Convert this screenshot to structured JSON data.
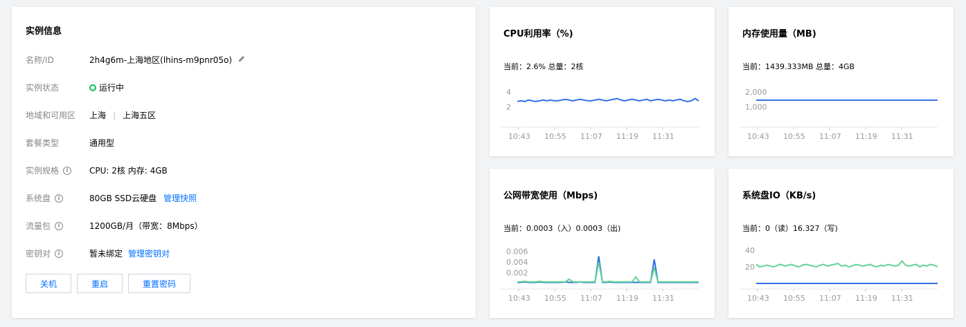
{
  "instance": {
    "title": "实例信息",
    "rows": [
      {
        "label": "名称/ID",
        "value": "2h4g6m-上海地区(lhins-m9pnr05o)",
        "has_edit": true
      },
      {
        "label": "实例状态",
        "value": "运行中",
        "status": "running"
      },
      {
        "label": "地域和可用区",
        "region": "上海",
        "sep": "|",
        "zone": "上海五区"
      },
      {
        "label": "套餐类型",
        "value": "通用型"
      },
      {
        "label": "实例规格",
        "value": "CPU: 2核 内存: 4GB",
        "info": true
      },
      {
        "label": "系统盘",
        "value": "80GB SSD云硬盘",
        "link": "管理快照",
        "info": true
      },
      {
        "label": "流量包",
        "value": "1200GB/月（带宽：8Mbps）",
        "info": true
      },
      {
        "label": "密钥对",
        "value": "暂未绑定",
        "link": "管理密钥对",
        "info": true
      }
    ],
    "buttons": {
      "shutdown": "关机",
      "restart": "重启",
      "reset_password": "重置密码"
    }
  },
  "colors": {
    "blue": "#2f6fe4",
    "green": "#5fd394",
    "link": "#006eff",
    "status_green": "#0abf5b"
  },
  "metrics": {
    "cpu": {
      "title": "CPU利用率（%)",
      "summary": "当前：2.6% 总量：2核"
    },
    "memory": {
      "title": "内存使用量（MB)",
      "summary": "当前：1439.333MB 总量：4GB"
    },
    "bandwidth": {
      "title": "公网带宽使用（Mbps)",
      "summary": "当前：0.0003（入）0.0003（出)"
    },
    "disk": {
      "title": "系统盘IO（KB/s)",
      "summary": "当前：0（读）16.327（写)"
    }
  },
  "chart_data": [
    {
      "type": "line",
      "x_ticks": [
        "10:43",
        "10:55",
        "11:07",
        "11:19",
        "11:31"
      ],
      "y_ticks": [
        "4",
        "2"
      ],
      "ylim": [
        0,
        5
      ],
      "series": [
        {
          "values": [
            2.7,
            2.8,
            2.7,
            2.9,
            2.8,
            2.7,
            2.8,
            2.9,
            2.8,
            2.9,
            2.8,
            2.8,
            2.9,
            3.0,
            2.9,
            2.8,
            2.9,
            3.0,
            2.9,
            2.8,
            2.8,
            2.9,
            3.0,
            2.9,
            2.8,
            2.9,
            3.0,
            3.1,
            2.9,
            2.8,
            2.9,
            3.0,
            2.9,
            2.8,
            2.9,
            3.0,
            2.8,
            2.9,
            3.0,
            2.9,
            2.8,
            2.9,
            2.8,
            2.9,
            3.0,
            2.8,
            2.7,
            2.8,
            3.1,
            2.8
          ],
          "color": "#2f6fe4"
        }
      ],
      "grid": false
    },
    {
      "type": "line",
      "x_ticks": [
        "10:43",
        "10:55",
        "11:07",
        "11:19",
        "11:31"
      ],
      "y_ticks": [
        "2,000",
        "1,000"
      ],
      "ylim": [
        0,
        2500
      ],
      "series": [
        {
          "values": [
            1440,
            1440,
            1440,
            1440,
            1440,
            1440,
            1440,
            1440,
            1440,
            1440,
            1440,
            1440,
            1440,
            1440,
            1440,
            1440,
            1440,
            1440,
            1440,
            1440
          ],
          "color": "#2f6fe4"
        }
      ],
      "grid": false
    },
    {
      "type": "line",
      "x_ticks": [
        "10:43",
        "10:55",
        "11:07",
        "11:19",
        "11:31"
      ],
      "y_ticks": [
        "0.006",
        "0.004",
        "0.002"
      ],
      "ylim": [
        0,
        0.007
      ],
      "series": [
        {
          "name": "in",
          "values": [
            0.0002,
            0.0002,
            0.0003,
            0.0002,
            0.0002,
            0.0002,
            0.0003,
            0.0002,
            0.0002,
            0.0002,
            0.0002,
            0.0002,
            0.0002,
            0.0003,
            0.0002,
            0.0002,
            0.0002,
            0.0003,
            0.0002,
            0.0002,
            0.0002,
            0.0002,
            0.0051,
            0.0002,
            0.0002,
            0.0003,
            0.0002,
            0.0002,
            0.0002,
            0.0002,
            0.0002,
            0.0002,
            0.0002,
            0.0002,
            0.0002,
            0.0002,
            0.0002,
            0.0045,
            0.0002,
            0.0002,
            0.0002,
            0.0002,
            0.0002,
            0.0002,
            0.0002,
            0.0002,
            0.0002,
            0.0002,
            0.0002,
            0.0002
          ],
          "color": "#2f6fe4"
        },
        {
          "name": "out",
          "values": [
            0.0003,
            0.0003,
            0.0004,
            0.0003,
            0.0003,
            0.0003,
            0.0004,
            0.0003,
            0.0003,
            0.0003,
            0.0003,
            0.0003,
            0.0003,
            0.0003,
            0.0008,
            0.0003,
            0.0003,
            0.0003,
            0.0003,
            0.0003,
            0.0003,
            0.0003,
            0.004,
            0.0003,
            0.0003,
            0.0004,
            0.0003,
            0.0003,
            0.0003,
            0.0003,
            0.0003,
            0.0003,
            0.0012,
            0.0003,
            0.0003,
            0.0003,
            0.0003,
            0.003,
            0.0003,
            0.0003,
            0.0003,
            0.0003,
            0.0003,
            0.0003,
            0.0003,
            0.0003,
            0.0003,
            0.0003,
            0.0003,
            0.0003
          ],
          "color": "#5fd394"
        }
      ],
      "grid": false
    },
    {
      "type": "line",
      "x_ticks": [
        "10:43",
        "10:55",
        "11:07",
        "11:19",
        "11:31"
      ],
      "y_ticks": [
        "40",
        "20"
      ],
      "ylim": [
        0,
        45
      ],
      "series": [
        {
          "name": "write",
          "values": [
            23,
            20,
            21,
            22,
            21,
            20,
            22,
            23,
            21,
            22,
            23,
            21,
            20,
            22,
            23,
            22,
            21,
            20,
            22,
            23,
            21,
            22,
            23,
            24,
            21,
            22,
            20,
            21,
            23,
            22,
            21,
            22,
            23,
            21,
            20,
            22,
            21,
            23,
            22,
            21,
            22,
            27,
            22,
            21,
            22,
            23,
            20,
            22,
            21,
            23,
            22,
            20
          ],
          "color": "#5fd394"
        },
        {
          "name": "read",
          "values": [
            0,
            0,
            0,
            0,
            0,
            0,
            0,
            0,
            0,
            0,
            0,
            0,
            0,
            0,
            0,
            0,
            0,
            0,
            0,
            0
          ],
          "color": "#2f6fe4"
        }
      ],
      "grid": false
    }
  ]
}
